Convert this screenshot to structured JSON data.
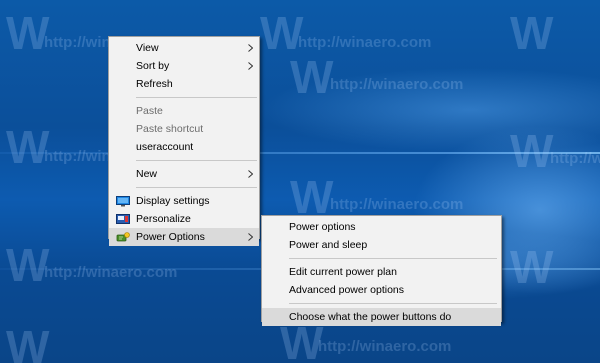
{
  "desktop": {
    "watermark_logo": "W",
    "watermark_text": "http://winaero.com"
  },
  "context_menu": {
    "items": [
      {
        "label": "View",
        "has_submenu": true,
        "disabled": false
      },
      {
        "label": "Sort by",
        "has_submenu": true,
        "disabled": false
      },
      {
        "label": "Refresh",
        "has_submenu": false,
        "disabled": false
      },
      {
        "label": "Paste",
        "has_submenu": false,
        "disabled": true
      },
      {
        "label": "Paste shortcut",
        "has_submenu": false,
        "disabled": true
      },
      {
        "label": "useraccount",
        "has_submenu": false,
        "disabled": false
      },
      {
        "label": "New",
        "has_submenu": true,
        "disabled": false
      },
      {
        "label": "Display settings",
        "icon": "display-icon",
        "disabled": false
      },
      {
        "label": "Personalize",
        "icon": "personalize-icon",
        "disabled": false
      },
      {
        "label": "Power Options",
        "icon": "power-options-icon",
        "has_submenu": true,
        "highlighted": true
      }
    ]
  },
  "power_submenu": {
    "items": [
      {
        "label": "Power options"
      },
      {
        "label": "Power and sleep"
      },
      {
        "label": "Edit current power plan"
      },
      {
        "label": "Advanced power options"
      },
      {
        "label": "Choose what the power buttons do",
        "highlighted": true
      }
    ]
  },
  "colors": {
    "desktop_blue": "#0b4f9a",
    "menu_background": "#f2f2f2",
    "highlight": "#dadada",
    "disabled_text": "#6d6d6d"
  }
}
